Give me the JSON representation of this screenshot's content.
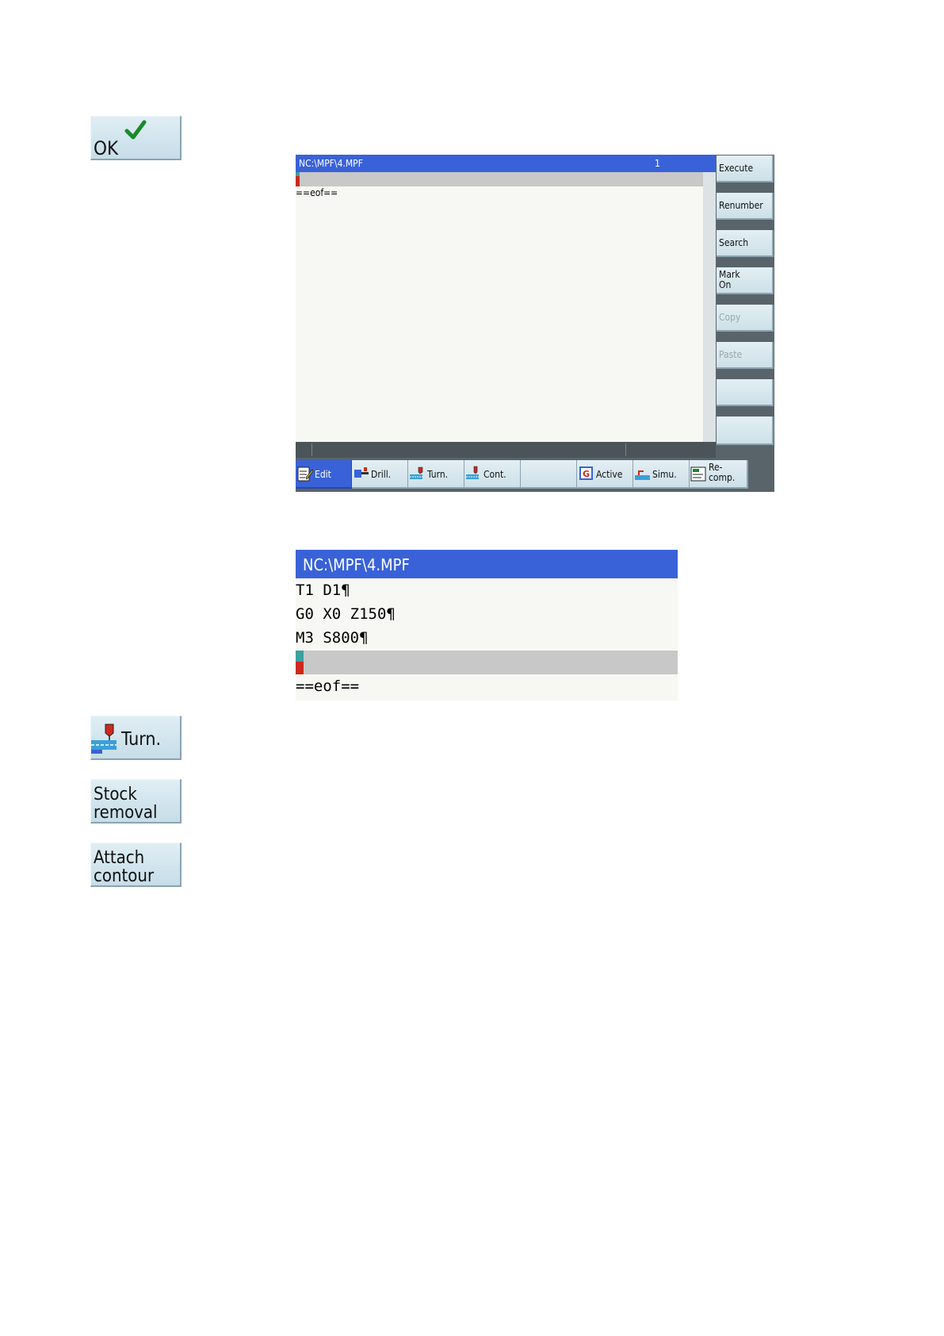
{
  "softkeys": {
    "ok": {
      "label": "OK",
      "icon": "checkmark-icon"
    },
    "turn": {
      "label": "Turn.",
      "icon": "turning-tool-icon"
    },
    "stock_removal": {
      "label": "Stock\nremoval"
    },
    "attach_contour": {
      "label": "Attach\ncontour"
    }
  },
  "editor": {
    "title": "NC:\\MPF\\4.MPF",
    "line_number": "1",
    "eof": "==eof==",
    "vertical_softkeys": [
      {
        "label": "Execute",
        "enabled": true
      },
      {
        "label": "Renumber",
        "enabled": true
      },
      {
        "label": "Search",
        "enabled": true
      },
      {
        "label": "Mark\nOn",
        "enabled": true
      },
      {
        "label": "Copy",
        "enabled": false
      },
      {
        "label": "Paste",
        "enabled": false
      },
      {
        "label": "",
        "enabled": true
      },
      {
        "label": "",
        "enabled": true
      }
    ],
    "horizontal_softkeys": [
      {
        "label": "Edit",
        "icon": "edit-icon",
        "active": true
      },
      {
        "label": "Drill.",
        "icon": "drill-icon"
      },
      {
        "label": "Turn.",
        "icon": "turning-tool-icon"
      },
      {
        "label": "Cont.",
        "icon": "contour-icon"
      },
      {
        "label": "",
        "icon": ""
      },
      {
        "label": "Active",
        "icon": "g-code-icon"
      },
      {
        "label": "Simu.",
        "icon": "simulation-icon"
      },
      {
        "label": "Re-\ncomp.",
        "icon": "recompile-icon"
      }
    ]
  },
  "program": {
    "title": "NC:\\MPF\\4.MPF",
    "lines": [
      "T1 D1¶",
      "G0 X0 Z150¶",
      "M3 S800¶"
    ],
    "eof": "==eof=="
  },
  "colors": {
    "title_bar": "#3a62d8",
    "softkey_face": "#d4e6ee",
    "softkey_frame": "#59646a",
    "cursor_red": "#cc2a1c",
    "cursor_teal": "#3aa0a0"
  }
}
